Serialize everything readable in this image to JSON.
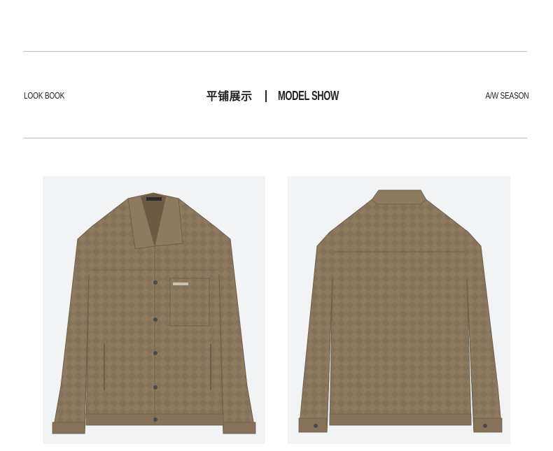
{
  "header": {
    "left_label": "LOOK BOOK",
    "title_cn": "平铺展示",
    "title_en": "MODEL SHOW",
    "right_label": "A/W SEASON"
  },
  "colors": {
    "rule": "#bdbdbd",
    "panel_bg": "#f1f3f5",
    "jacket": "#8e7b5f",
    "jacket_shade": "#7a6a51"
  },
  "images": [
    {
      "name": "jacket-front-image",
      "view": "front"
    },
    {
      "name": "jacket-back-image",
      "view": "back"
    }
  ]
}
